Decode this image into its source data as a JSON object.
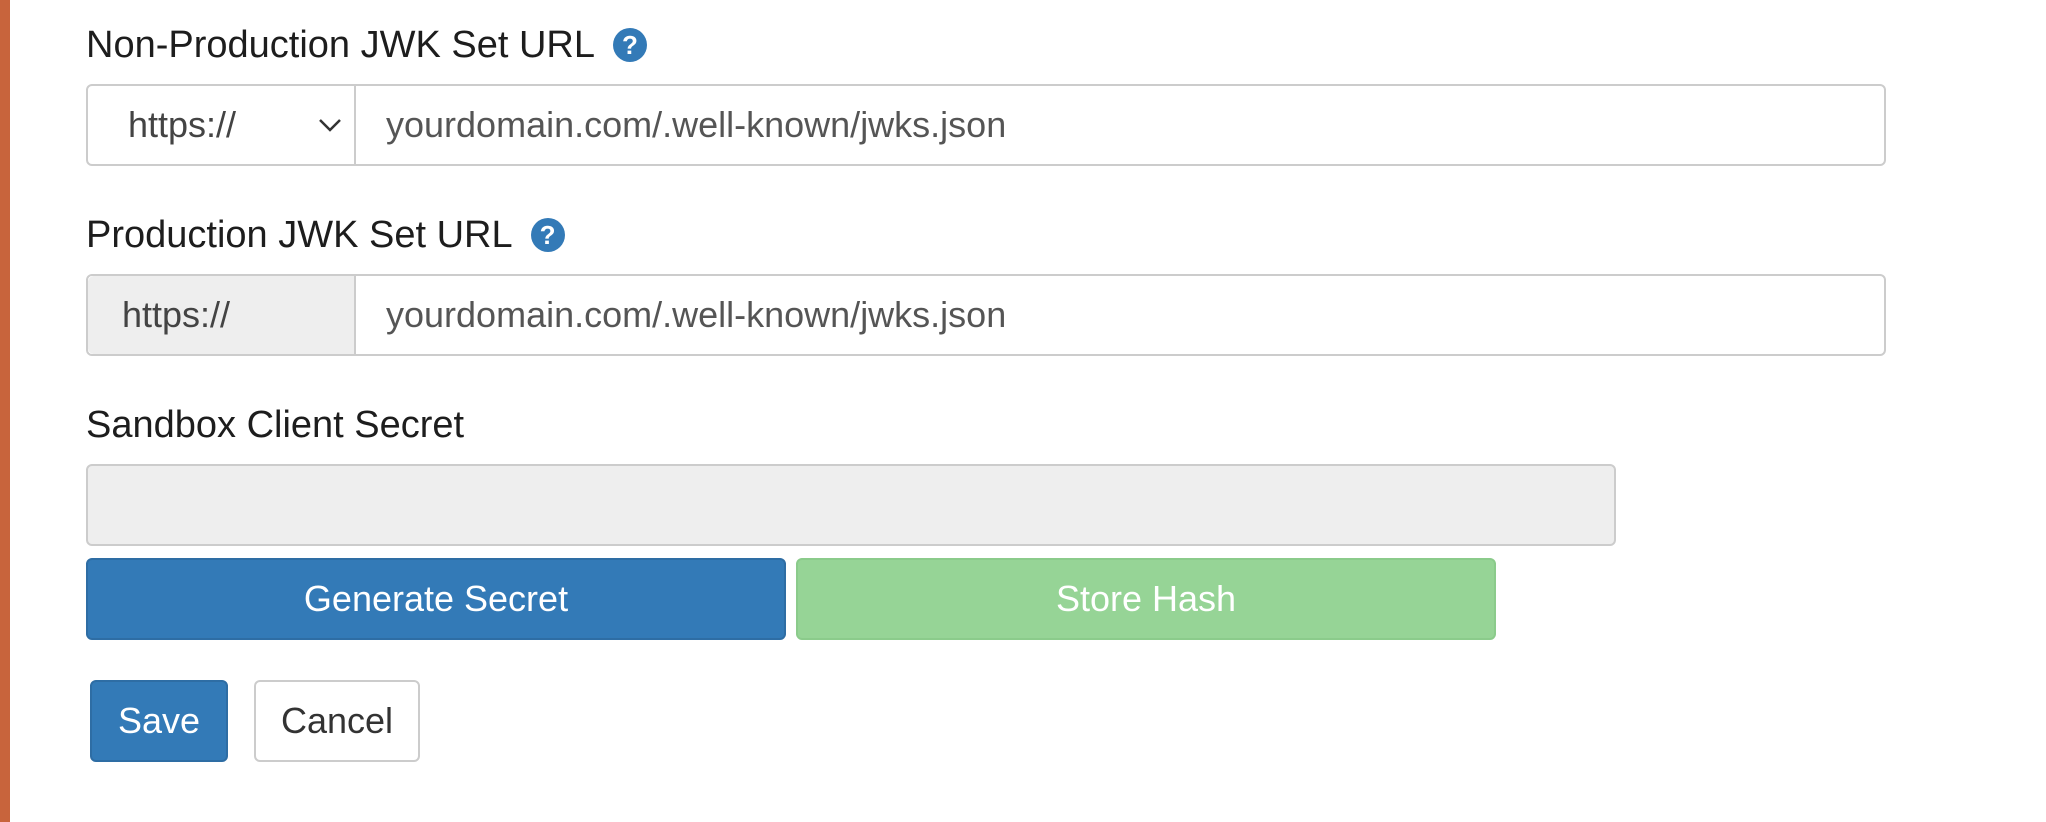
{
  "nonprod_jwk": {
    "label": "Non-Production JWK Set URL",
    "help_icon": "question-circle-icon",
    "protocol": "https://",
    "placeholder": "yourdomain.com/.well-known/jwks.json"
  },
  "prod_jwk": {
    "label": "Production JWK Set URL",
    "help_icon": "question-circle-icon",
    "protocol": "https://",
    "placeholder": "yourdomain.com/.well-known/jwks.json"
  },
  "sandbox_secret": {
    "label": "Sandbox Client Secret",
    "value": ""
  },
  "buttons": {
    "generate": "Generate Secret",
    "store": "Store Hash",
    "save": "Save",
    "cancel": "Cancel"
  },
  "colors": {
    "primary": "#337ab7",
    "success_disabled": "#96d496",
    "readonly_bg": "#eeeeee",
    "border": "#cccccc"
  }
}
